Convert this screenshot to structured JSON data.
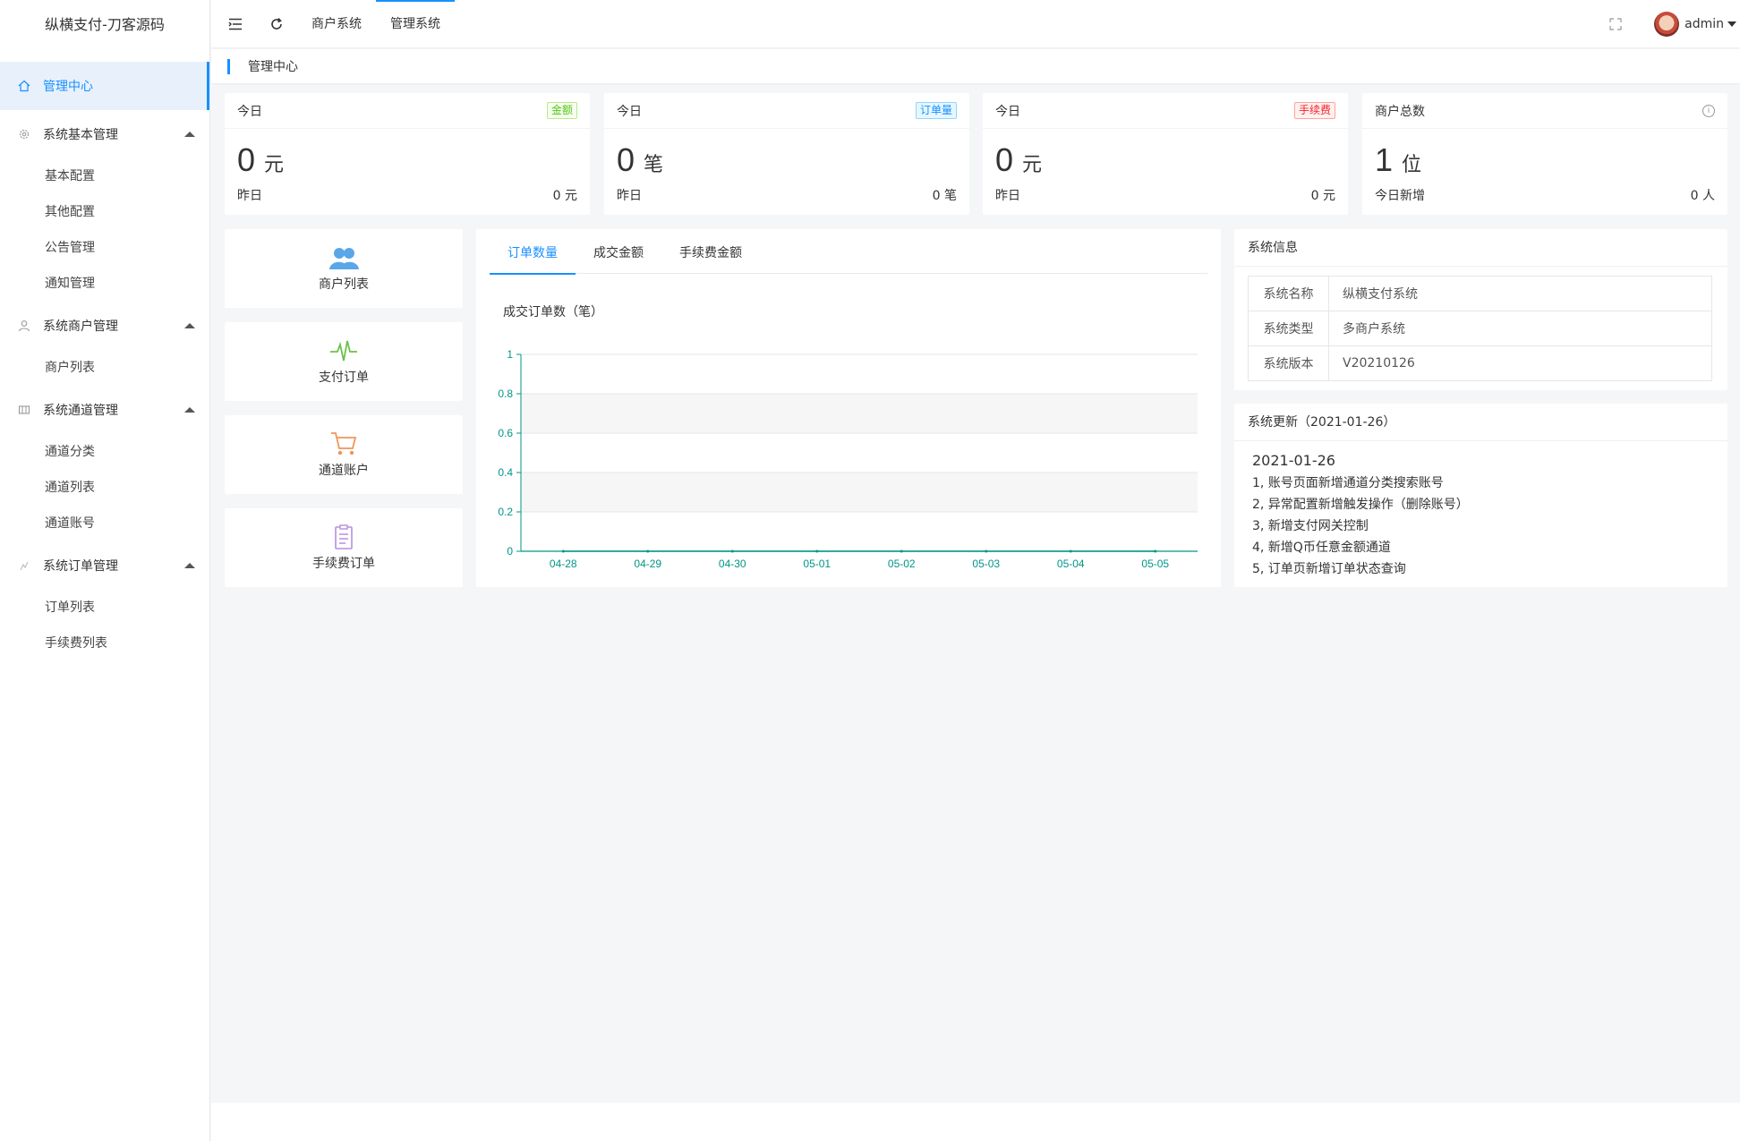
{
  "brand": "纵横支付-刀客源码",
  "sidebar": {
    "active": "管理中心",
    "groups": [
      {
        "label": "系统基本管理",
        "items": [
          "基本配置",
          "其他配置",
          "公告管理",
          "通知管理"
        ]
      },
      {
        "label": "系统商户管理",
        "items": [
          "商户列表"
        ]
      },
      {
        "label": "系统通道管理",
        "items": [
          "通道分类",
          "通道列表",
          "通道账号"
        ]
      },
      {
        "label": "系统订单管理",
        "items": [
          "订单列表",
          "手续费列表"
        ]
      }
    ]
  },
  "header": {
    "links": [
      "商户系统",
      "管理系统"
    ],
    "user": "admin"
  },
  "breadcrumb": "管理中心",
  "stats": [
    {
      "label": "今日",
      "tag": "金额",
      "value": "0",
      "unit": "元",
      "foot_label": "昨日",
      "foot_value": "0 元"
    },
    {
      "label": "今日",
      "tag": "订单量",
      "value": "0",
      "unit": "笔",
      "foot_label": "昨日",
      "foot_value": "0 笔"
    },
    {
      "label": "今日",
      "tag": "手续费",
      "value": "0",
      "unit": "元",
      "foot_label": "昨日",
      "foot_value": "0 元"
    },
    {
      "label": "商户总数",
      "tag": "i",
      "value": "1",
      "unit": "位",
      "foot_label": "今日新增",
      "foot_value": "0 人"
    }
  ],
  "quick_links": [
    {
      "label": "商户列表",
      "icon": "users-icon"
    },
    {
      "label": "支付订单",
      "icon": "pulse-icon"
    },
    {
      "label": "通道账户",
      "icon": "cart-icon"
    },
    {
      "label": "手续费订单",
      "icon": "clipboard-icon"
    }
  ],
  "chart_tabs": [
    "订单数量",
    "成交金额",
    "手续费金额"
  ],
  "chart_data": {
    "type": "line",
    "title": "成交订单数（笔）",
    "x": [
      "04-28",
      "04-29",
      "04-30",
      "05-01",
      "05-02",
      "05-03",
      "05-04",
      "05-05"
    ],
    "series": [
      {
        "values": [
          0,
          0,
          0,
          0,
          0,
          0,
          0,
          0
        ]
      }
    ],
    "ylim": [
      0,
      1
    ],
    "yticks": [
      "0",
      "0.2",
      "0.4",
      "0.6",
      "0.8",
      "1"
    ],
    "grid": true,
    "color": "#009688"
  },
  "sys_info": {
    "title": "系统信息",
    "rows": [
      {
        "k": "系统名称",
        "v": "纵横支付系统"
      },
      {
        "k": "系统类型",
        "v": "多商户系统"
      },
      {
        "k": "系统版本",
        "v": "V20210126"
      }
    ]
  },
  "updates": {
    "title": "系统更新（2021-01-26）",
    "date": "2021-01-26",
    "lines": [
      "1, 账号页面新增通道分类搜索账号",
      "2, 异常配置新增触发操作（删除账号）",
      "3, 新增支付网关控制",
      "4, 新增Q币任意金额通道",
      "5, 订单页新增订单状态查询"
    ]
  },
  "colors": {
    "accent": "#1890ff",
    "chart": "#009688"
  }
}
